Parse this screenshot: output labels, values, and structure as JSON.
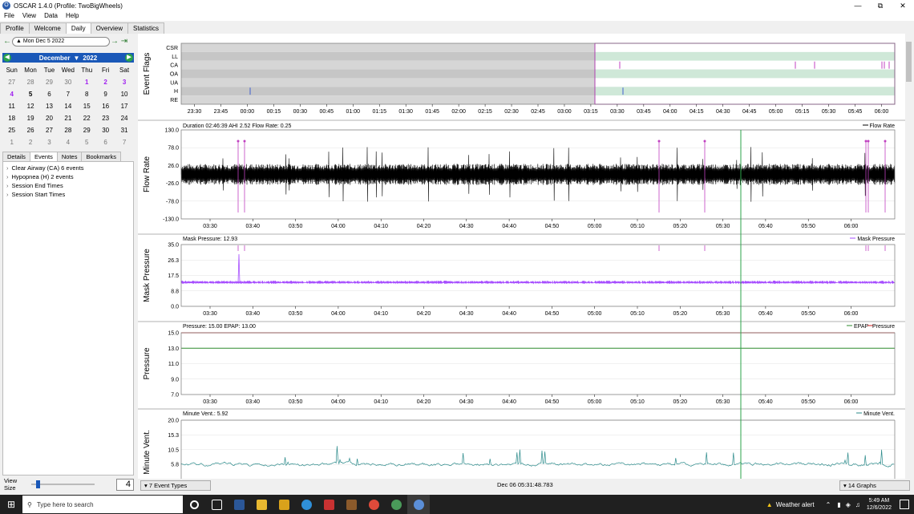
{
  "window": {
    "title": "OSCAR 1.4.0 (Profile: TwoBigWheels)"
  },
  "menu": [
    "File",
    "View",
    "Data",
    "Help"
  ],
  "tabs": [
    {
      "label": "Profile",
      "active": false
    },
    {
      "label": "Welcome",
      "active": false
    },
    {
      "label": "Daily",
      "active": true
    },
    {
      "label": "Overview",
      "active": false
    },
    {
      "label": "Statistics",
      "active": false
    }
  ],
  "date_nav": {
    "current": "Mon Dec 5 2022"
  },
  "calendar": {
    "month": "December",
    "year": "2022",
    "weekdays": [
      "Sun",
      "Mon",
      "Tue",
      "Wed",
      "Thu",
      "Fri",
      "Sat"
    ],
    "weeks": [
      [
        {
          "d": "27",
          "c": "gray"
        },
        {
          "d": "28",
          "c": "gray"
        },
        {
          "d": "29",
          "c": "gray"
        },
        {
          "d": "30",
          "c": "gray"
        },
        {
          "d": "1",
          "c": "purple"
        },
        {
          "d": "2",
          "c": "purple"
        },
        {
          "d": "3",
          "c": "purple"
        }
      ],
      [
        {
          "d": "4",
          "c": "purple"
        },
        {
          "d": "5",
          "c": "sel"
        },
        {
          "d": "6",
          "c": ""
        },
        {
          "d": "7",
          "c": ""
        },
        {
          "d": "8",
          "c": ""
        },
        {
          "d": "9",
          "c": ""
        },
        {
          "d": "10",
          "c": ""
        }
      ],
      [
        {
          "d": "11",
          "c": ""
        },
        {
          "d": "12",
          "c": ""
        },
        {
          "d": "13",
          "c": ""
        },
        {
          "d": "14",
          "c": ""
        },
        {
          "d": "15",
          "c": ""
        },
        {
          "d": "16",
          "c": ""
        },
        {
          "d": "17",
          "c": ""
        }
      ],
      [
        {
          "d": "18",
          "c": ""
        },
        {
          "d": "19",
          "c": ""
        },
        {
          "d": "20",
          "c": ""
        },
        {
          "d": "21",
          "c": ""
        },
        {
          "d": "22",
          "c": ""
        },
        {
          "d": "23",
          "c": ""
        },
        {
          "d": "24",
          "c": ""
        }
      ],
      [
        {
          "d": "25",
          "c": ""
        },
        {
          "d": "26",
          "c": ""
        },
        {
          "d": "27",
          "c": ""
        },
        {
          "d": "28",
          "c": ""
        },
        {
          "d": "29",
          "c": ""
        },
        {
          "d": "30",
          "c": ""
        },
        {
          "d": "31",
          "c": ""
        }
      ],
      [
        {
          "d": "1",
          "c": "gray"
        },
        {
          "d": "2",
          "c": "gray"
        },
        {
          "d": "3",
          "c": "gray"
        },
        {
          "d": "4",
          "c": "gray"
        },
        {
          "d": "5",
          "c": "gray"
        },
        {
          "d": "6",
          "c": "gray"
        },
        {
          "d": "7",
          "c": "gray"
        }
      ]
    ]
  },
  "subtabs": [
    {
      "label": "Details",
      "active": false
    },
    {
      "label": "Events",
      "active": true
    },
    {
      "label": "Notes",
      "active": false
    },
    {
      "label": "Bookmarks",
      "active": false
    }
  ],
  "events": [
    "Clear Airway (CA) 6 events",
    "Hypopnea (H) 2 events",
    "Session End Times",
    "Session Start Times"
  ],
  "view_size": {
    "label": "View Size",
    "value": "4"
  },
  "graphs": {
    "event_flags": {
      "ylabel": "Event Flags",
      "rows": [
        "CSR",
        "LL",
        "CA",
        "OA",
        "UA",
        "H",
        "RE"
      ],
      "xticks": [
        "23:30",
        "23:45",
        "00:00",
        "00:15",
        "00:30",
        "00:45",
        "01:00",
        "01:15",
        "01:30",
        "01:45",
        "02:00",
        "02:15",
        "02:30",
        "02:45",
        "03:00",
        "03:15",
        "03:30",
        "03:45",
        "04:00",
        "04:15",
        "04:30",
        "04:45",
        "05:00",
        "05:15",
        "05:30",
        "05:45",
        "06:00"
      ]
    },
    "time_ticks": [
      "03:30",
      "03:40",
      "03:50",
      "04:00",
      "04:10",
      "04:20",
      "04:30",
      "04:40",
      "04:50",
      "05:00",
      "05:10",
      "05:20",
      "05:30",
      "05:40",
      "05:50",
      "06:00"
    ],
    "flow_rate": {
      "ylabel": "Flow Rate",
      "info": "Duration 02:46:39 AHI 2.52 Flow Rate: 0.25",
      "legend": "Flow Rate",
      "yticks": [
        "130.0",
        "78.0",
        "26.0",
        "-26.0",
        "-78.0",
        "-130.0"
      ]
    },
    "mask_pressure": {
      "ylabel": "Mask Pressure",
      "info": "Mask Pressure: 12.93",
      "legend": "Mask Pressure",
      "yticks": [
        "35.0",
        "26.3",
        "17.5",
        "8.8",
        "0.0"
      ]
    },
    "pressure": {
      "ylabel": "Pressure",
      "info": "Pressure: 15.00 EPAP: 13.00",
      "legend_epap": "EPAP",
      "legend_pressure": "Pressure",
      "yticks": [
        "15.0",
        "13.0",
        "11.0",
        "9.0",
        "7.0"
      ]
    },
    "minute_vent": {
      "ylabel": "Minute Vent.",
      "info": "Minute Vent.: 5.92",
      "legend": "Minute Vent.",
      "yticks": [
        "20.0",
        "15.3",
        "10.5",
        "5.8"
      ]
    }
  },
  "status": {
    "event_types": "7 Event Types",
    "cursor_time": "Dec 06 05:31:48.783",
    "graphs_count": "14 Graphs"
  },
  "taskbar": {
    "search_placeholder": "Type here to search",
    "weather": "Weather alert",
    "time": "5:49 AM",
    "date": "12/6/2022"
  },
  "colors": {
    "flag_band_light": "#cfe8d8",
    "flag_band_pink": "#b040b0",
    "mask_pressure": "#a64dff",
    "epap": "#2e8b2e",
    "pressure": "#d02020",
    "minute_vent": "#2a8a8a",
    "cursor": "#2ba34a",
    "calendar_header": "#1a58b8"
  }
}
